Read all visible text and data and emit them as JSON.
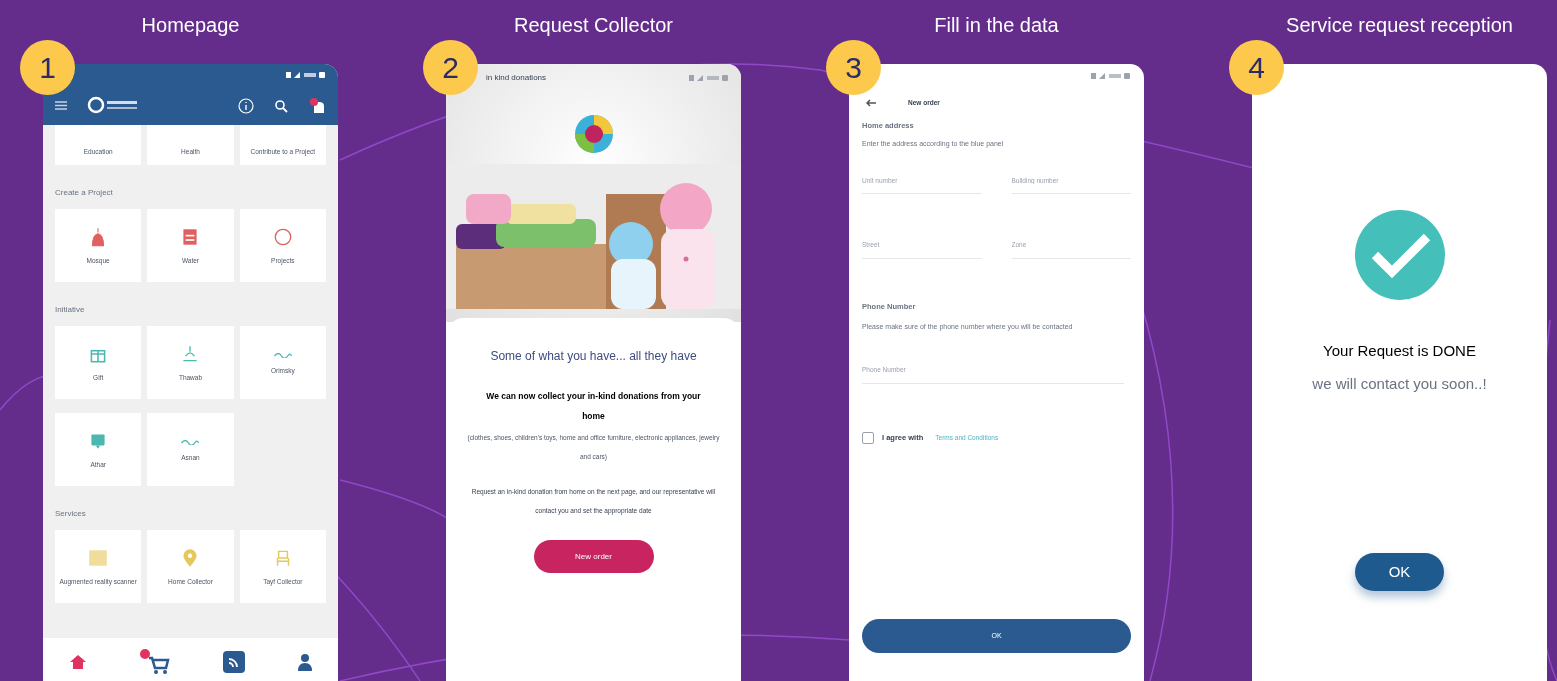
{
  "steps": [
    {
      "number": "1",
      "title": "Homepage"
    },
    {
      "number": "2",
      "title": "Request Collector"
    },
    {
      "number": "3",
      "title": "Fill in the data"
    },
    {
      "number": "4",
      "title": "Service request reception"
    }
  ],
  "homepage": {
    "top_tiles": [
      "Education",
      "Health",
      "Contribute to a Project"
    ],
    "sections": [
      {
        "title": "Create a Project",
        "tiles": [
          "Mosque",
          "Water",
          "Projects"
        ]
      },
      {
        "title": "Initiative",
        "tiles": [
          "Gift",
          "Thawab",
          "Orimsky",
          "Athar",
          "Asnan"
        ]
      },
      {
        "title": "Services",
        "tiles": [
          "Augmented reality scanner",
          "Home Collector",
          "Tayf Collector"
        ]
      }
    ],
    "nav": [
      {
        "selected": true
      },
      {
        "selected": false
      },
      {
        "selected": false
      },
      {
        "selected": false
      }
    ]
  },
  "request_collector": {
    "title": "in kind donations",
    "heading": "Some of what you have... all they have",
    "lead": "We can now collect your in-kind donations from your home",
    "items": "(clothes, shoes, children's toys, home and office furniture, electronic appliances, jewelry and cars)",
    "note": "Request an in-kind donation from home on the next page, and our representative will contact you and set the appropriate date",
    "button": "New order"
  },
  "fill_data": {
    "title": "New order",
    "address_title": "Home address",
    "address_hint": "Enter the address according to the blue panel",
    "address_fields": [
      {
        "placeholder": "Unit number"
      },
      {
        "placeholder": "Building number"
      },
      {
        "placeholder": "Street"
      },
      {
        "placeholder": "Zone"
      }
    ],
    "phone_title": "Phone Number",
    "phone_hint": "Please make sure of the phone number where you will be contacted",
    "phone_field": {
      "placeholder": "Phone Number"
    },
    "agree": {
      "checked": false,
      "label": "I agree with",
      "link": "Terms and Conditions"
    },
    "button": "OK"
  },
  "reception": {
    "title": "Your Request is DONE",
    "subtitle": "we will contact you soon..!",
    "button": "OK"
  }
}
